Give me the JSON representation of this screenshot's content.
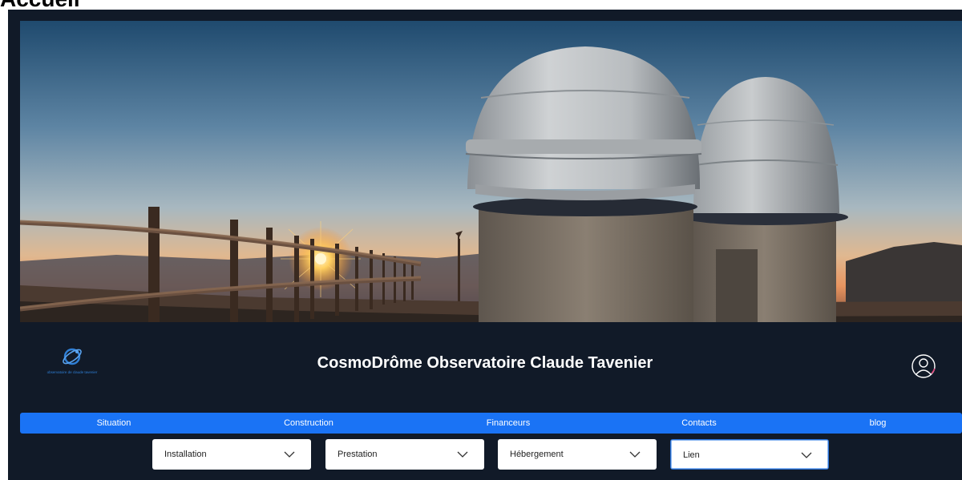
{
  "page": {
    "heading": "Accueil"
  },
  "brand": {
    "logo_caption": "observatoire de claude tavenier",
    "title": "CosmoDrôme Observatoire Claude Tavenier"
  },
  "nav": {
    "items": [
      {
        "label": "Situation"
      },
      {
        "label": "Construction"
      },
      {
        "label": "Financeurs"
      },
      {
        "label": "Contacts"
      },
      {
        "label": "blog"
      }
    ]
  },
  "dropdowns": [
    {
      "label": "Installation"
    },
    {
      "label": "Prestation"
    },
    {
      "label": "Hébergement"
    },
    {
      "label": "Lien",
      "active": true
    }
  ],
  "icons": {
    "logo": "orbit-logo-icon",
    "user": "user-account-icon",
    "chevron": "chevron-down-icon"
  },
  "colors": {
    "background": "#111a28",
    "nav": "#1a73f5",
    "accent": "#2f7fd6",
    "user_icon_accent": "#e0457b"
  }
}
